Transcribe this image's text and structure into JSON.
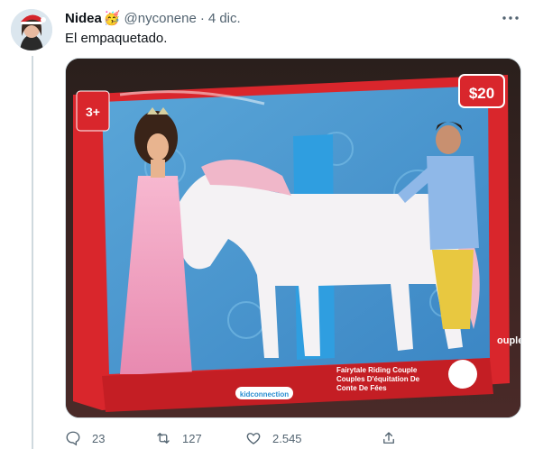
{
  "tweet": {
    "author_name": "Nidea",
    "author_emoji": "🥳",
    "handle": "@nyconene",
    "separator": "·",
    "date": "4 dic.",
    "text": "El empaquetado."
  },
  "media": {
    "price_tag": "$20",
    "age_label": "3+",
    "product_line": "Fairytale Riding Couple",
    "product_line_fr": "Couples D'équitation De",
    "product_line_fr2": "Conte De Fées",
    "brand": "kidconnection",
    "side_text": "ouple"
  },
  "actions": {
    "replies": "23",
    "retweets": "127",
    "likes": "2.545"
  },
  "colors": {
    "text": "#0f1419",
    "muted": "#536471",
    "box_red": "#d9262c",
    "box_blue": "#2b8fd1"
  }
}
